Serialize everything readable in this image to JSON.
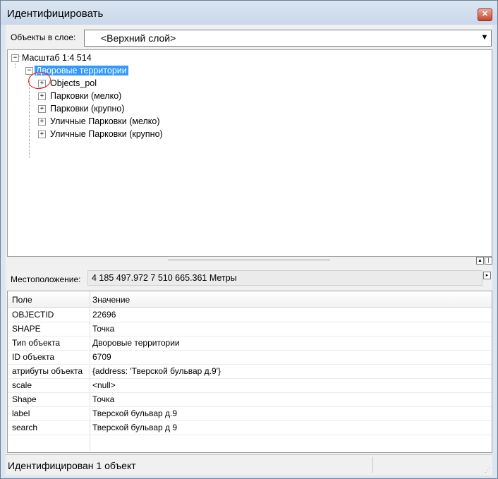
{
  "window": {
    "title": "Идентифицировать",
    "close_glyph": "✕"
  },
  "layer": {
    "label": "Объекты в слое:",
    "selected": "<Верхний слой>"
  },
  "tree": {
    "root": "Масштаб 1:4 514",
    "group": "Дворовые территории",
    "items": [
      "Objects_pol",
      "Парковки (мелко)",
      "Парковки (крупно)",
      "Уличные Парковки (мелко)",
      "Уличные Парковки (крупно)"
    ]
  },
  "location": {
    "label": "Местоположение:",
    "value": "4 185 497.972  7 510 665.361 Метры"
  },
  "grid": {
    "headers": [
      "Поле",
      "Значение"
    ],
    "rows": [
      [
        "OBJECTID",
        "22696"
      ],
      [
        "SHAPE",
        "Точка"
      ],
      [
        "Тип объекта",
        "Дворовые территории"
      ],
      [
        "ID объекта",
        "6709"
      ],
      [
        "атрибуты объекта",
        "{address: 'Тверской бульвар д.9'}"
      ],
      [
        "scale",
        "<null>"
      ],
      [
        "Shape",
        "Точка"
      ],
      [
        "label",
        "Тверской бульвар д.9"
      ],
      [
        "search",
        "Тверской бульвар д 9"
      ]
    ]
  },
  "status": {
    "text": "Идентифицирован 1 объект"
  },
  "icons": {
    "close": "close-icon",
    "dropdown": "chevron-down-icon",
    "expand": "plus-box-icon",
    "collapse": "minus-box-icon"
  }
}
